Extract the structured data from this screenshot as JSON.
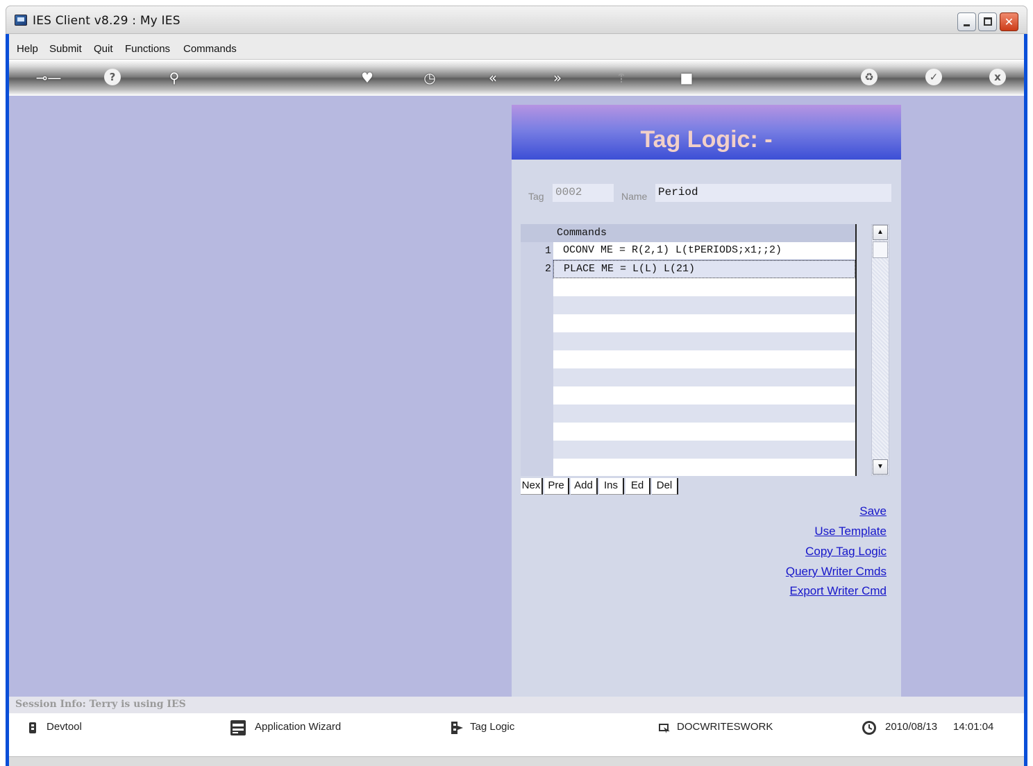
{
  "window": {
    "title": "IES Client v8.29 : My IES"
  },
  "menu": [
    "Help",
    "Submit",
    "Quit",
    "Functions",
    "Commands"
  ],
  "toolbar_icons": [
    "key-icon",
    "help-icon",
    "search-icon",
    "heart-icon",
    "clock-icon",
    "rewind-icon",
    "fast-forward-icon",
    "upload-icon",
    "stop-icon",
    "recycle-icon",
    "check-icon",
    "close-icon"
  ],
  "panel": {
    "title": "Tag Logic: -",
    "tag_label": "Tag",
    "tag_value": "0002",
    "name_label": "Name",
    "name_value": "Period"
  },
  "grid": {
    "header": "Commands",
    "rows": [
      {
        "num": "1",
        "text": "OCONV ME = R(2,1) L(tPERIODS;x1;;2)"
      },
      {
        "num": "2",
        "text": "PLACE ME = L(L) L(21)"
      }
    ],
    "buttons": [
      "Nex",
      "Pre",
      "Add",
      "Ins",
      "Ed",
      "Del"
    ]
  },
  "links": [
    "Save",
    "Use Template",
    "Copy Tag Logic",
    "Query Writer Cmds",
    "Export Writer Cmd"
  ],
  "session": "Session Info: Terry is using IES",
  "status": {
    "devtool": "Devtool",
    "wizard": "Application Wizard",
    "taglogic": "Tag Logic",
    "docwrites": "DOCWRITESWORK",
    "date": "2010/08/13",
    "time": "14:01:04"
  }
}
